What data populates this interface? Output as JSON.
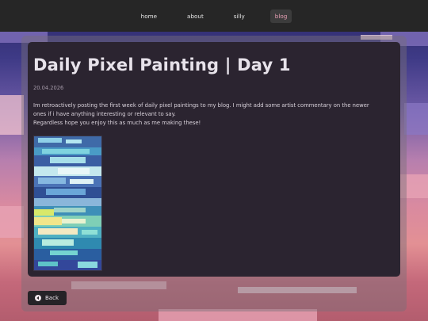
{
  "nav": {
    "items": [
      {
        "label": "home",
        "active": false
      },
      {
        "label": "about",
        "active": false
      },
      {
        "label": "silly",
        "active": false
      },
      {
        "label": "blog",
        "active": true
      }
    ]
  },
  "post": {
    "title": "Daily Pixel Painting | Day 1",
    "date": "20.04.2026",
    "paragraphs": [
      "Im retroactively posting the first week of daily pixel paintings to my blog. I might add some artist commentary on the newer ones if i have anything interesting or relevant to say.",
      "Regardless hope you enjoy this as much as me making these!"
    ]
  },
  "back_button": {
    "label": "Back",
    "icon": "left-arrow-circle-icon"
  },
  "colors": {
    "topbar": "#262626",
    "card": "#2b2430",
    "title": "#e7e2ea",
    "active_nav": "#e8a0b4"
  }
}
